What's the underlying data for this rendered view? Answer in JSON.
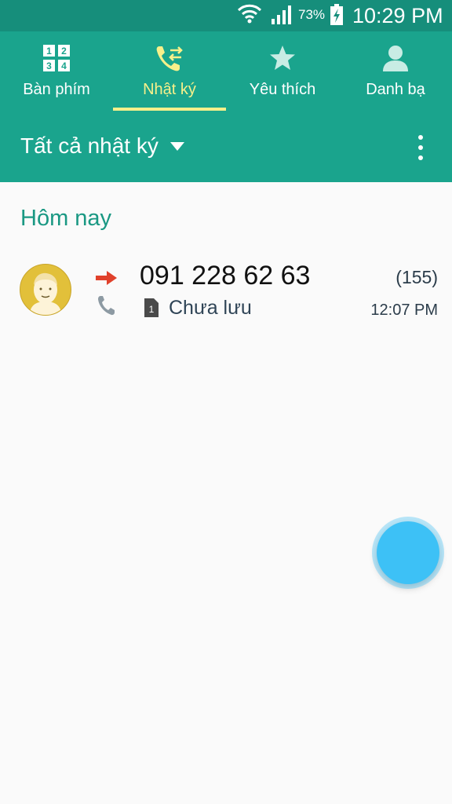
{
  "status_bar": {
    "battery_percent": "73%",
    "time": "10:29 PM",
    "icons": [
      "wifi-icon",
      "signal-icon",
      "battery-charging-icon"
    ]
  },
  "tabs": [
    {
      "label": "Bàn phím",
      "icon": "keypad-icon",
      "active": false
    },
    {
      "label": "Nhật ký",
      "icon": "call-log-icon",
      "active": true
    },
    {
      "label": "Yêu thích",
      "icon": "star-icon",
      "active": false
    },
    {
      "label": "Danh bạ",
      "icon": "contact-icon",
      "active": false
    }
  ],
  "filter": {
    "label": "Tất cả nhật ký",
    "icons": [
      "dropdown-caret-icon",
      "more-options-icon"
    ]
  },
  "section": {
    "title": "Hôm nay"
  },
  "call_log": [
    {
      "number": "091 228 62 63",
      "count": "(155)",
      "sim": "1",
      "status": "Chưa lưu",
      "time": "12:07 PM",
      "direction_icon": "outgoing-arrow-icon",
      "type_icon": "phone-icon"
    }
  ],
  "colors": {
    "status_bar": "#168e7b",
    "header": "#1aa48d",
    "active_tab": "#f7f08a",
    "section_title": "#1a9883",
    "fab": "#3dc1f6",
    "outgoing_arrow": "#e0412b"
  }
}
